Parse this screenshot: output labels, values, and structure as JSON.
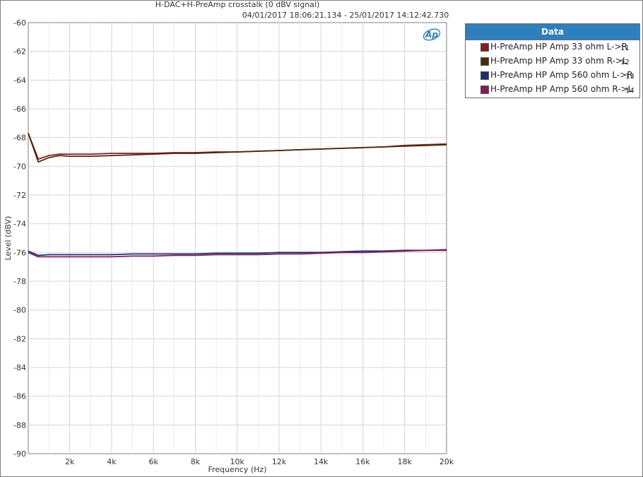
{
  "header": {
    "title": "H-DAC+H-PreAmp crosstalk (0 dBV signal)",
    "subtitle": "04/01/2017 18:06:21.134 - 25/01/2017 14:12:42.730"
  },
  "legend": {
    "title": "Data",
    "items": [
      {
        "label": "H-PreAmp HP Amp 33 ohm L->R",
        "num": "11",
        "color": "#8b1a1a"
      },
      {
        "label": "H-PreAmp HP Amp 33 ohm R->L",
        "num": "12",
        "color": "#4a2a0a"
      },
      {
        "label": "H-PreAmp HP Amp 560 ohm L->R",
        "num": "13",
        "color": "#1a2f7a"
      },
      {
        "label": "H-PreAmp HP Amp 560 ohm R->L",
        "num": "14",
        "color": "#8a1a5a"
      }
    ]
  },
  "logo": "Ap",
  "chart_data": {
    "type": "line",
    "title": "H-DAC+H-PreAmp crosstalk (0 dBV signal)",
    "subtitle": "04/01/2017 18:06:21.134 - 25/01/2017 14:12:42.730",
    "xlabel": "Frequency (Hz)",
    "ylabel": "Level (dBV)",
    "xlim": [
      20,
      20000
    ],
    "ylim": [
      -90,
      -60
    ],
    "x_ticks": [
      2000,
      4000,
      6000,
      8000,
      10000,
      12000,
      14000,
      16000,
      18000,
      20000
    ],
    "x_tick_labels": [
      "2k",
      "4k",
      "6k",
      "8k",
      "10k",
      "12k",
      "14k",
      "16k",
      "18k",
      "20k"
    ],
    "y_ticks": [
      -60,
      -62,
      -64,
      -66,
      -68,
      -70,
      -72,
      -74,
      -76,
      -78,
      -80,
      -82,
      -84,
      -86,
      -88,
      -90
    ],
    "y_tick_labels": [
      "-60",
      "-62",
      "-64",
      "-66",
      "-68",
      "-70",
      "-72",
      "-74",
      "-76",
      "-78",
      "-80",
      "-82",
      "-84",
      "-86",
      "-88",
      "-90"
    ],
    "grid": true,
    "legend_position": "right",
    "x": [
      20,
      500,
      1000,
      1500,
      2000,
      3000,
      4000,
      5000,
      6000,
      7000,
      8000,
      9000,
      10000,
      11000,
      12000,
      13000,
      14000,
      15000,
      16000,
      17000,
      18000,
      19000,
      20000
    ],
    "series": [
      {
        "name": "H-PreAmp HP Amp 33 ohm L->R",
        "color": "#8b1a1a",
        "values": [
          -67.7,
          -69.5,
          -69.25,
          -69.15,
          -69.15,
          -69.15,
          -69.1,
          -69.1,
          -69.1,
          -69.05,
          -69.05,
          -69.0,
          -69.0,
          -68.95,
          -68.9,
          -68.85,
          -68.8,
          -68.75,
          -68.7,
          -68.65,
          -68.55,
          -68.5,
          -68.45
        ]
      },
      {
        "name": "H-PreAmp HP Amp 33 ohm R->L",
        "color": "#4a2a0a",
        "values": [
          -67.7,
          -69.7,
          -69.4,
          -69.25,
          -69.3,
          -69.3,
          -69.25,
          -69.2,
          -69.15,
          -69.1,
          -69.1,
          -69.05,
          -69.0,
          -68.95,
          -68.9,
          -68.85,
          -68.8,
          -68.75,
          -68.7,
          -68.65,
          -68.6,
          -68.55,
          -68.5
        ]
      },
      {
        "name": "H-PreAmp HP Amp 560 ohm L->R",
        "color": "#1a2f7a",
        "values": [
          -75.9,
          -76.2,
          -76.15,
          -76.15,
          -76.15,
          -76.15,
          -76.15,
          -76.1,
          -76.1,
          -76.1,
          -76.1,
          -76.05,
          -76.05,
          -76.05,
          -76.0,
          -76.0,
          -76.0,
          -75.95,
          -75.9,
          -75.9,
          -75.85,
          -75.85,
          -75.8
        ]
      },
      {
        "name": "H-PreAmp HP Amp 560 ohm R->L",
        "color": "#8a1a5a",
        "values": [
          -76.0,
          -76.3,
          -76.3,
          -76.3,
          -76.3,
          -76.3,
          -76.3,
          -76.25,
          -76.25,
          -76.2,
          -76.2,
          -76.15,
          -76.15,
          -76.15,
          -76.1,
          -76.1,
          -76.05,
          -76.0,
          -76.0,
          -75.95,
          -75.9,
          -75.85,
          -75.85
        ]
      }
    ]
  }
}
